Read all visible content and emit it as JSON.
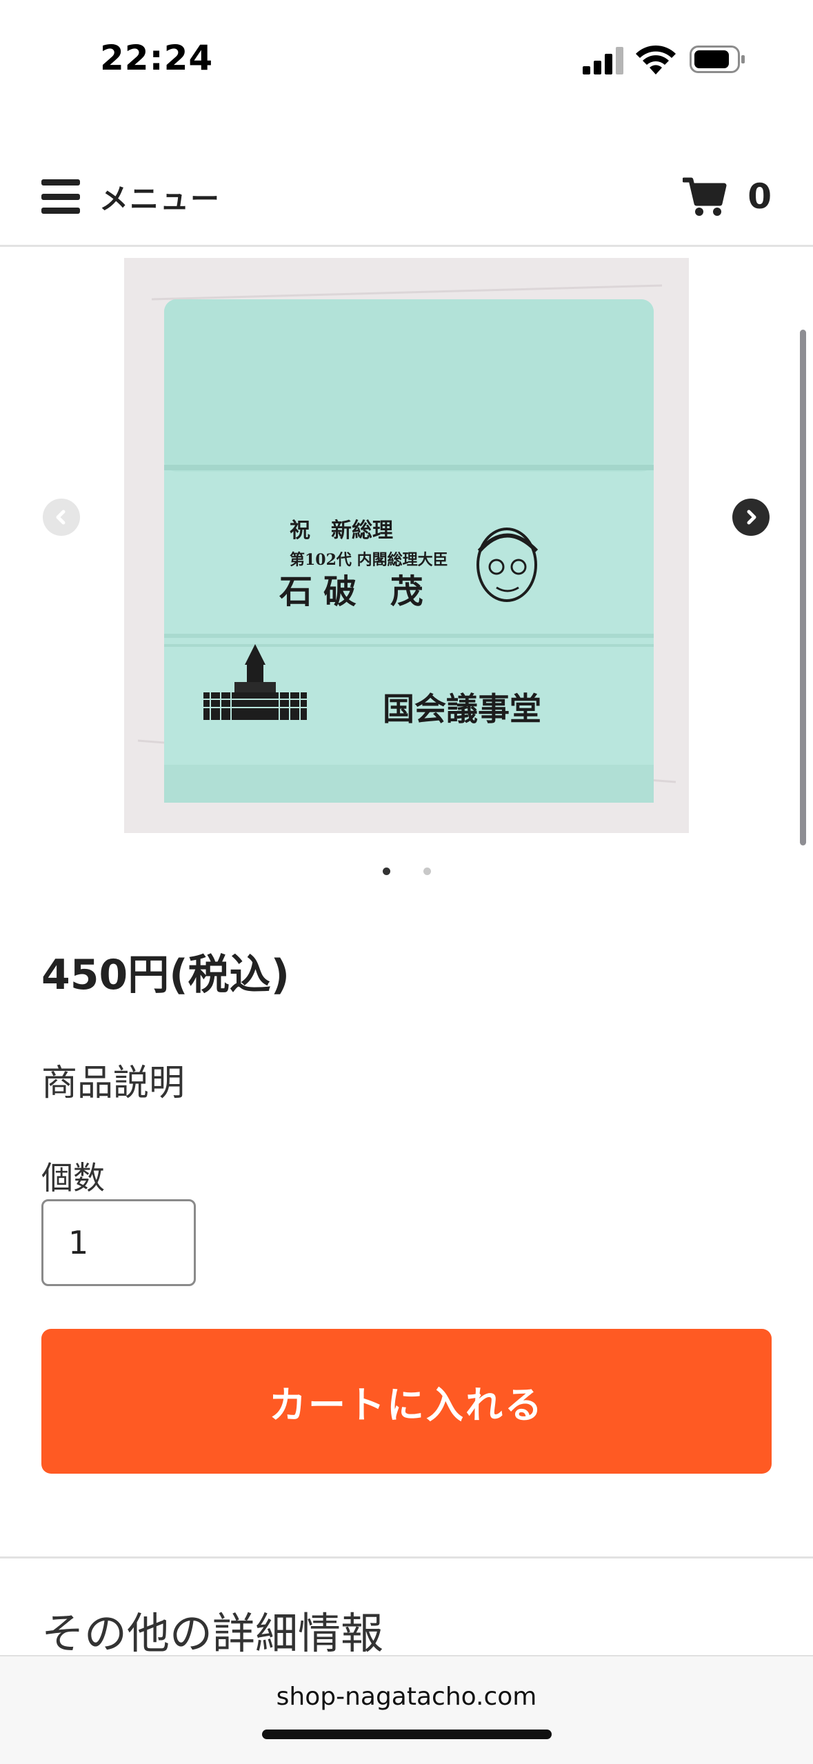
{
  "status_bar": {
    "time": "22:24"
  },
  "header": {
    "menu_label": "メニュー",
    "cart_count": "0"
  },
  "carousel": {
    "image_text": {
      "celebrate": "祝　新総理",
      "subtitle": "第102代 内閣総理大臣",
      "name": "石破 茂",
      "building": "国会議事堂"
    },
    "slides": 2,
    "active_slide": 1
  },
  "product": {
    "price": "450円(税込)",
    "description_label": "商品説明",
    "quantity_label": "個数",
    "quantity_value": "1",
    "add_to_cart_label": "カートに入れる"
  },
  "details": {
    "heading": "その他の詳細情報"
  },
  "browser": {
    "url": "shop-nagatacho.com"
  },
  "colors": {
    "accent": "#ff5a23",
    "towel": "#b9e6dd"
  }
}
